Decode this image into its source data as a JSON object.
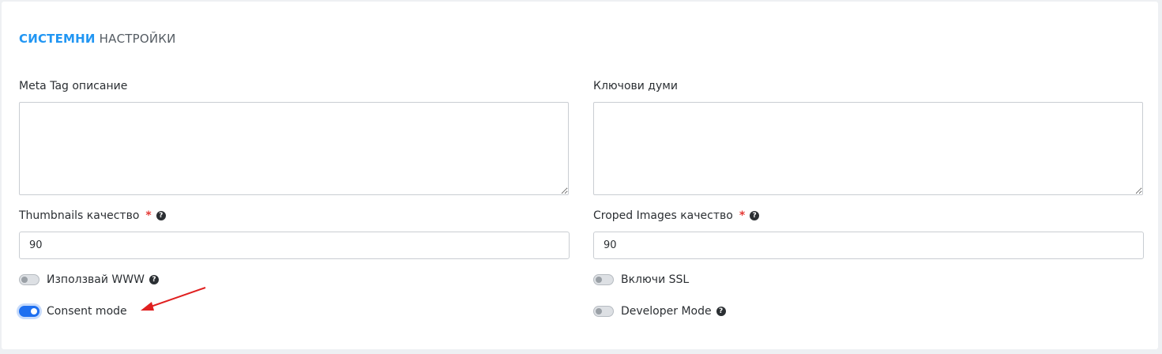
{
  "section": {
    "title_accent": "СИСТЕМНИ",
    "title_rest": "НАСТРОЙКИ"
  },
  "fields": {
    "meta_description": {
      "label": "Meta Tag описание",
      "value": ""
    },
    "keywords": {
      "label": "Ключови думи",
      "value": ""
    },
    "thumbnails_quality": {
      "label": "Thumbnails качество",
      "required_mark": "*",
      "value": "90"
    },
    "cropped_quality": {
      "label": "Croped Images качество",
      "required_mark": "*",
      "value": "90"
    }
  },
  "toggles": {
    "use_www": {
      "label": "Използвай WWW",
      "on": false
    },
    "enable_ssl": {
      "label": "Включи SSL",
      "on": false
    },
    "consent_mode": {
      "label": "Consent mode",
      "on": true
    },
    "developer_mode": {
      "label": "Developer Mode",
      "on": false
    }
  },
  "icons": {
    "help": "question-circle-icon"
  },
  "colors": {
    "accent": "#2196f3",
    "toggle_on": "#1e6ff0",
    "required": "#e53935",
    "annotation_arrow": "#e02020"
  }
}
